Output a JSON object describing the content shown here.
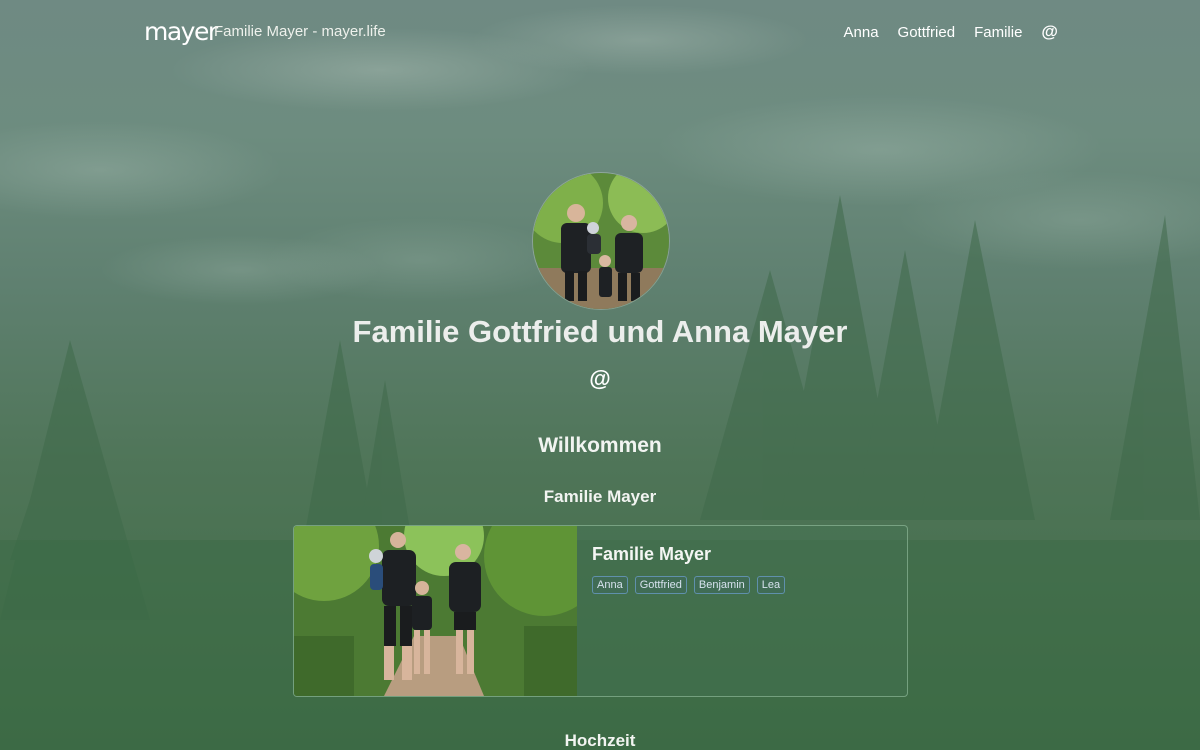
{
  "nav": {
    "logo": "mayer",
    "site_title": "Familie Mayer - mayer.life",
    "links": [
      "Anna",
      "Gottfried",
      "Familie"
    ],
    "at_symbol": "@"
  },
  "hero": {
    "title": "Familie Gottfried und Anna Mayer",
    "contact_symbol": "@"
  },
  "sections": {
    "welcome": "Willkommen",
    "group": "Familie Mayer",
    "next": "Hochzeit"
  },
  "card": {
    "title": "Familie Mayer",
    "tags": [
      "Anna",
      "Gottfried",
      "Benjamin",
      "Lea"
    ]
  },
  "colors": {
    "background": "#5a7d69",
    "card_border": "#a0c8aa",
    "tag_border": "#6ea0d2"
  }
}
